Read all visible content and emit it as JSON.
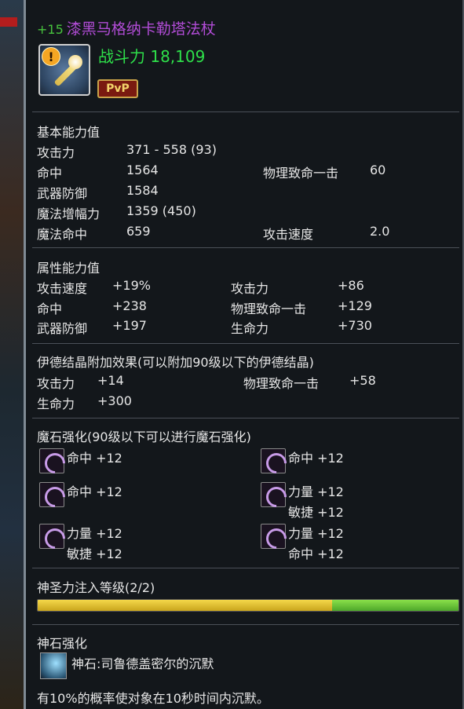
{
  "item": {
    "enhance": "+15",
    "name": "漆黑马格纳卡勒塔法杖",
    "power_label": "战斗力",
    "power_value": "18,109",
    "pvp_badge": "PvP",
    "warning_glyph": "!"
  },
  "basic": {
    "header": "基本能力值",
    "rows": [
      {
        "label": "攻击力",
        "value": "371 - 558 (93)"
      },
      {
        "label": "命中",
        "value": "1564",
        "label2": "物理致命一击",
        "value2": "60"
      },
      {
        "label": "武器防御",
        "value": "1584"
      },
      {
        "label": "魔法增幅力",
        "value": "1359 (450)"
      },
      {
        "label": "魔法命中",
        "value": "659",
        "label2": "攻击速度",
        "value2": "2.0"
      }
    ]
  },
  "attr": {
    "header": "属性能力值",
    "rows": [
      {
        "label": "攻击速度",
        "value": "+19%",
        "label2": "攻击力",
        "value2": "+86"
      },
      {
        "label": "命中",
        "value": "+238",
        "label2": "物理致命一击",
        "value2": "+129"
      },
      {
        "label": "武器防御",
        "value": "+197",
        "label2": "生命力",
        "value2": "+730"
      }
    ]
  },
  "idian": {
    "header": "伊德结晶附加效果(可以附加90级以下的伊德结晶)",
    "rows": [
      {
        "label": "攻击力",
        "value": "+14",
        "label2": "物理致命一击",
        "value2": "+58"
      },
      {
        "label": "生命力",
        "value": "+300"
      }
    ]
  },
  "manastone": {
    "header": "魔石强化(90级以下可以进行魔石强化)",
    "slots": [
      {
        "lines": [
          "命中 +12"
        ]
      },
      {
        "lines": [
          "命中 +12"
        ]
      },
      {
        "lines": [
          "命中 +12"
        ]
      },
      {
        "lines": [
          "力量 +12",
          "敏捷 +12"
        ]
      },
      {
        "lines": [
          "力量 +12",
          "敏捷 +12"
        ]
      },
      {
        "lines": [
          "力量 +12",
          "命中 +12"
        ]
      }
    ]
  },
  "holy": {
    "header": "神圣力注入等级(2/2)",
    "yellow_fraction": 0.7,
    "green_fraction": 0.3
  },
  "godstone": {
    "header": "神石强化",
    "name": "神石:司鲁德盖密尔的沉默",
    "desc": "有10%的概率使对象在10秒时间内沉默。"
  },
  "colors": {
    "title": "#b14cd6",
    "enhance": "#47c33e",
    "power": "#2ee04a",
    "header": "#ece3c4"
  }
}
